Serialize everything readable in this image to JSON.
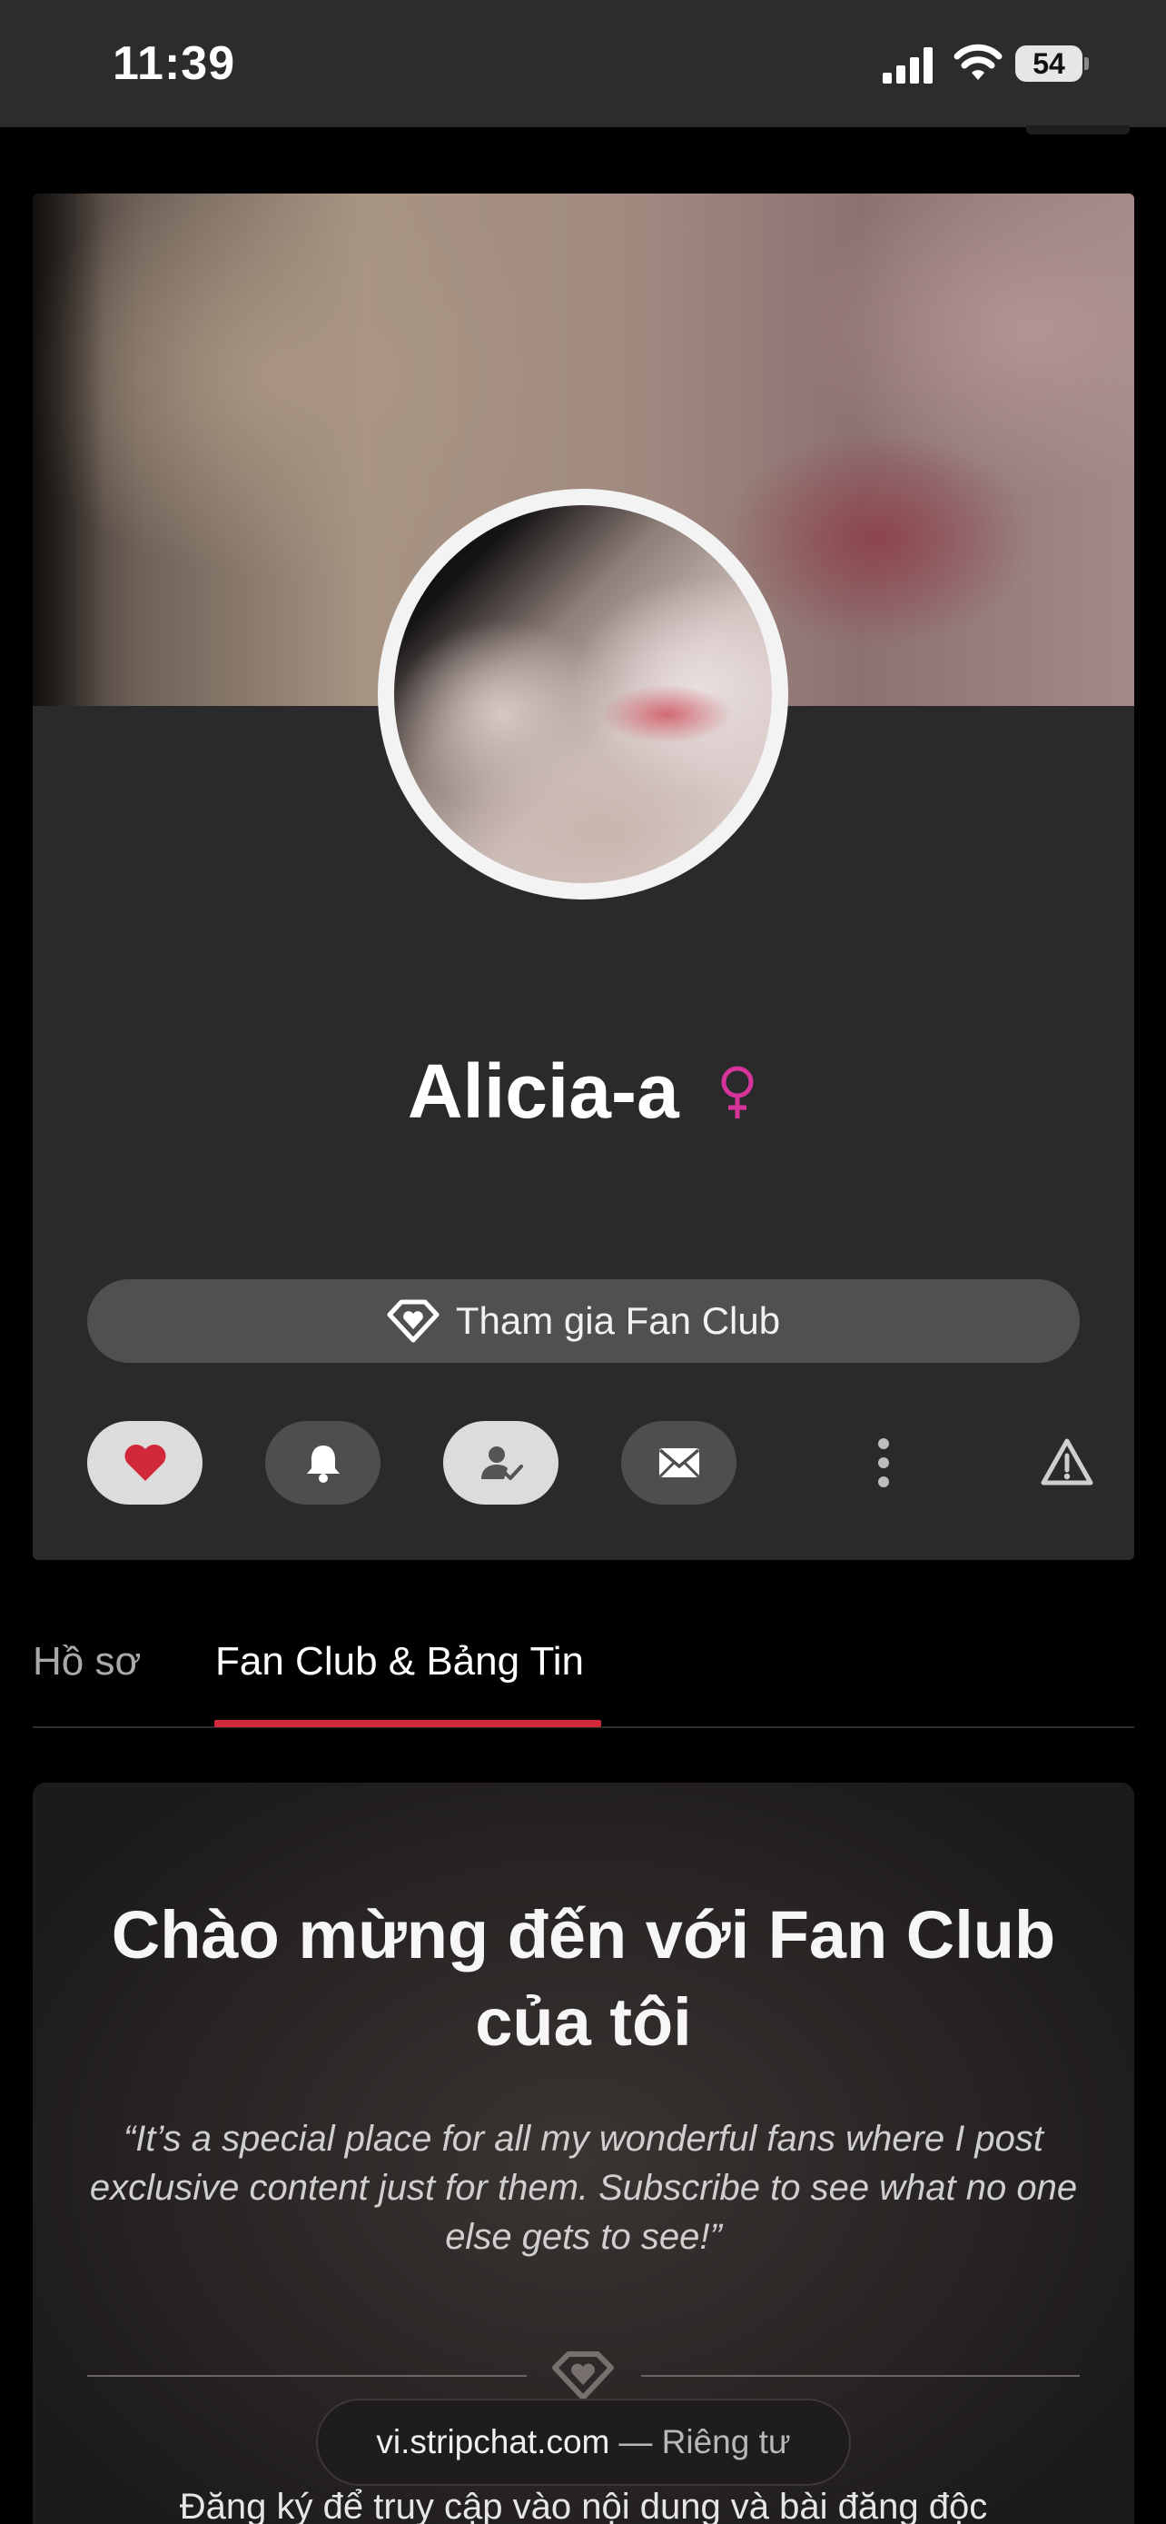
{
  "status_bar": {
    "time": "11:39",
    "battery_level": "54",
    "signal_icon": "cellular-signal-icon",
    "wifi_icon": "wifi-icon"
  },
  "profile": {
    "name": "Alicia-a",
    "gender_icon": "female-symbol-icon",
    "gender_color": "#d6349a",
    "fan_club_button": "Tham gia Fan Club",
    "actions": [
      {
        "icon": "heart-icon",
        "color": "#d1283a"
      },
      {
        "icon": "bell-icon"
      },
      {
        "icon": "user-check-icon"
      },
      {
        "icon": "mail-icon"
      },
      {
        "icon": "more-vertical-icon"
      },
      {
        "icon": "warning-icon"
      }
    ]
  },
  "tabs": {
    "profile": "Hồ sơ",
    "fan_club": "Fan Club & Bảng Tin",
    "active": "fan_club",
    "accent": "#d1283a"
  },
  "welcome": {
    "title": "Chào mừng đến với Fan Club của tôi",
    "quote": "“It’s a special place for all my wonderful fans where I post exclusive content just for them. Subscribe to see what no one else gets to see!”",
    "subtitle": "Đăng ký để truy cập vào nội dung và bài đăng độc"
  },
  "url_bar": {
    "domain": "vi.stripchat.com",
    "privacy": "— Riêng tư"
  }
}
